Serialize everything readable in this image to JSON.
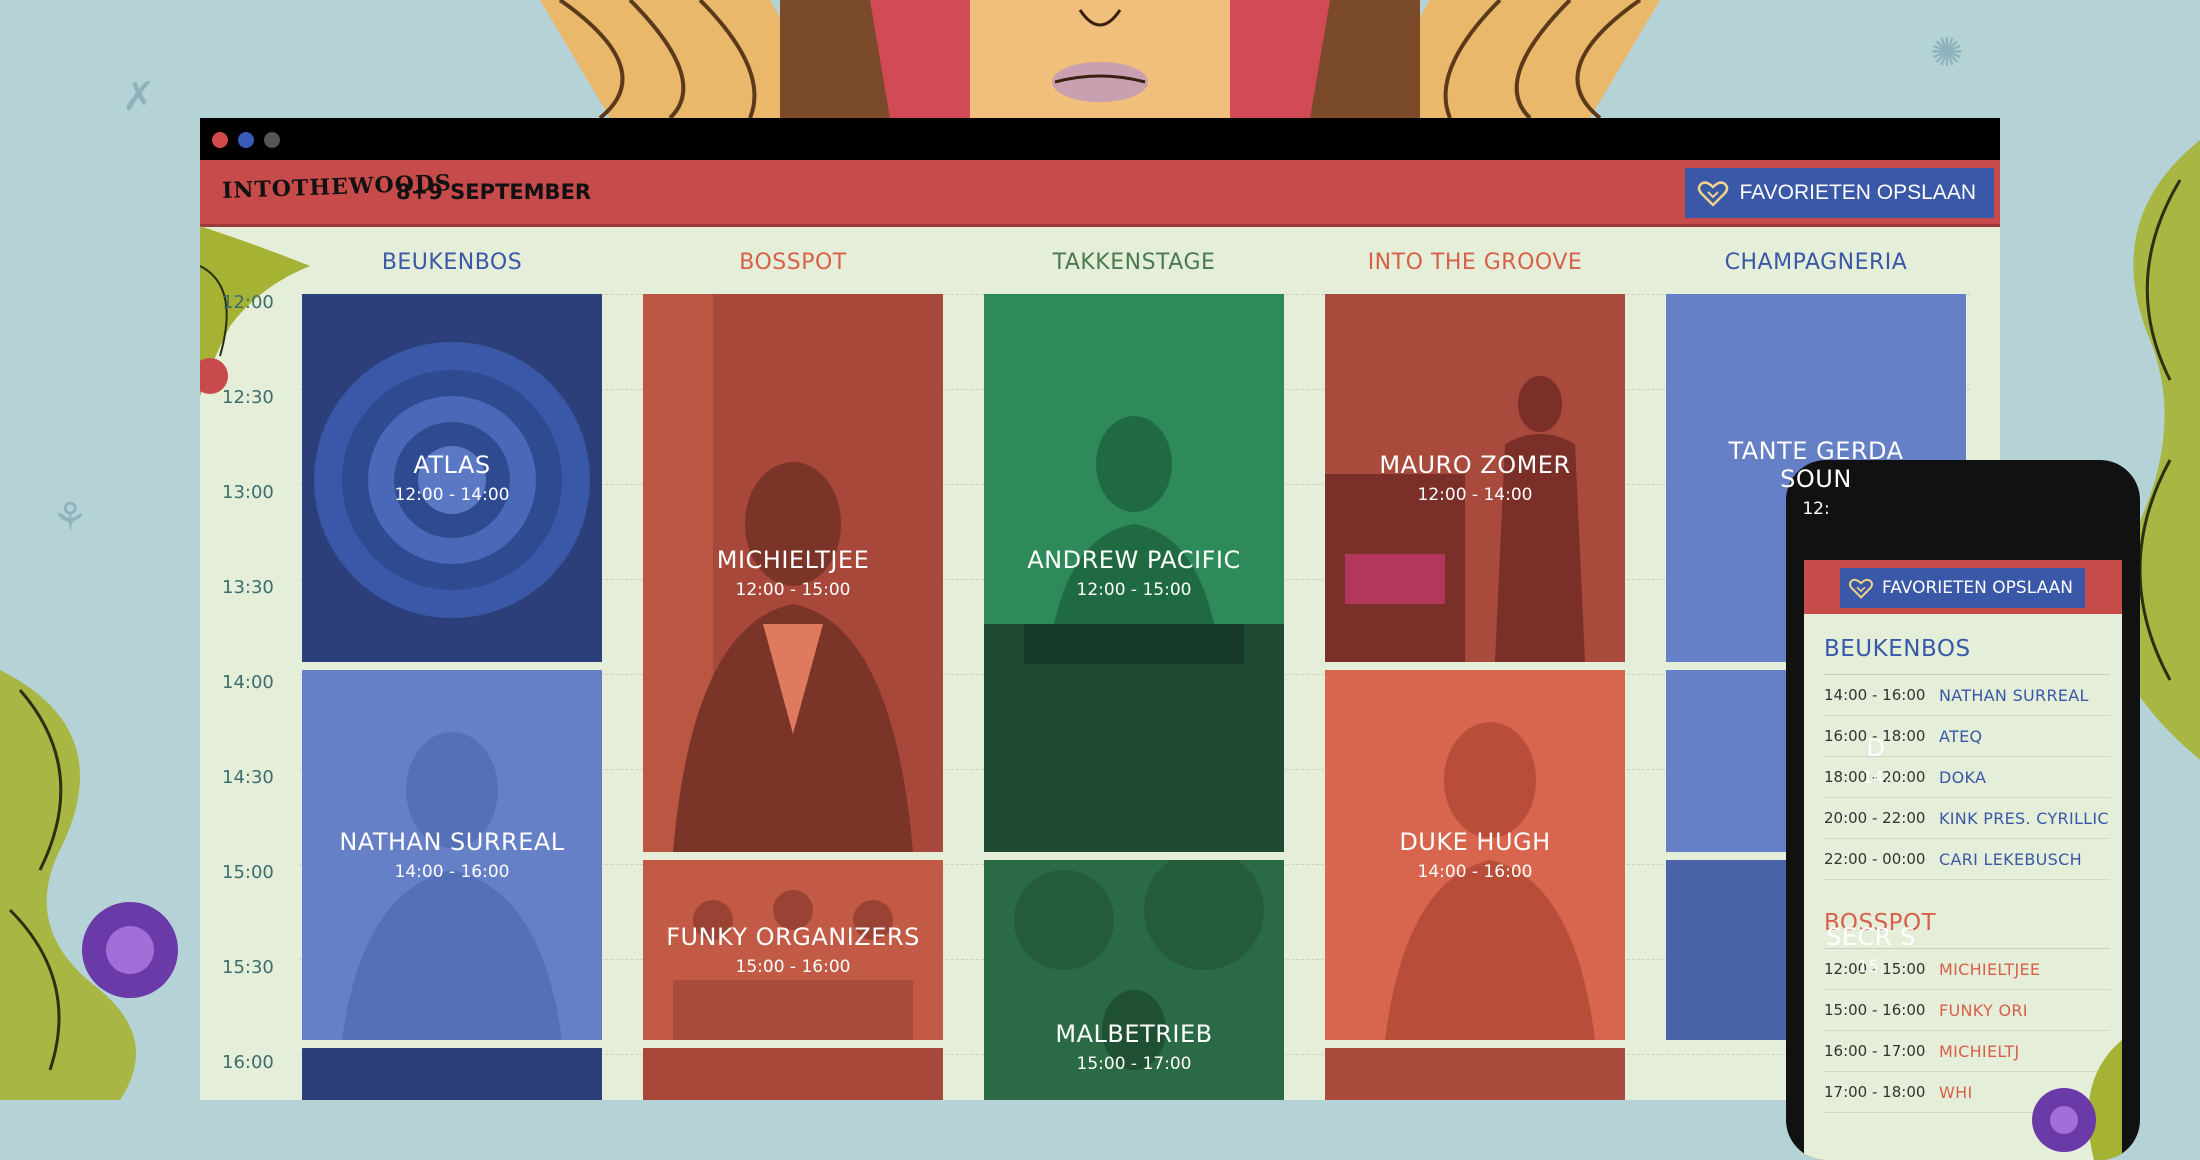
{
  "colors": {
    "background": "#b5d3d6",
    "header_red": "#c74b4a",
    "button_blue": "#3a58a8",
    "content_bg": "#e4eed8",
    "stage_blue": "#3a58a8",
    "stage_red": "#d8604a",
    "stage_green": "#4a7a4e"
  },
  "header": {
    "logo_text": "INTOTHEWOODS",
    "dates": "8+9 SEPTEMBER",
    "favorites_button": "FAVORIETEN OPSLAAN",
    "favorites_icon": "heart-icon"
  },
  "stages": [
    {
      "name": "BEUKENBOS",
      "color": "#3a58a8"
    },
    {
      "name": "BOSSPOT",
      "color": "#d8604a"
    },
    {
      "name": "TAKKENSTAGE",
      "color": "#4a7a4e"
    },
    {
      "name": "INTO THE GROOVE",
      "color": "#d8604a"
    },
    {
      "name": "CHAMPAGNERIA",
      "color": "#3a58a8"
    }
  ],
  "times": [
    "12:00",
    "12:30",
    "13:00",
    "13:30",
    "14:00",
    "14:30",
    "15:00",
    "15:30",
    "16:00"
  ],
  "timetable": {
    "atlas": {
      "artist": "ATLAS",
      "time": "12:00 - 14:00"
    },
    "nathan": {
      "artist": "NATHAN SURREAL",
      "time": "14:00 - 16:00"
    },
    "michieltjee": {
      "artist": "MICHIELTJEE",
      "time": "12:00 - 15:00"
    },
    "funky": {
      "artist": "FUNKY ORGANIZERS",
      "time": "15:00 - 16:00"
    },
    "andrew": {
      "artist": "ANDREW PACIFIC",
      "time": "12:00 - 15:00"
    },
    "malbetrieb": {
      "artist": "MALBETRIEB",
      "time": "15:00 - 17:00"
    },
    "mauro": {
      "artist": "MAURO ZOMER",
      "time": "12:00 - 14:00"
    },
    "duke": {
      "artist": "DUKE HUGH",
      "time": "14:00 - 16:00"
    },
    "tante": {
      "artist": "TANTE GERDA SOUN",
      "time": "12:"
    },
    "doka_partial": {
      "artist": "D",
      "time": "14:"
    },
    "secret_partial": {
      "artist": "SECR S",
      "time": "15:"
    }
  },
  "mobile": {
    "favorites_button": "FAVORIETEN OPSLAAN",
    "beukenbos": {
      "title": "BEUKENBOS",
      "rows": [
        {
          "time": "14:00 - 16:00",
          "artist": "NATHAN SURREAL"
        },
        {
          "time": "16:00 - 18:00",
          "artist": "ATEQ"
        },
        {
          "time": "18:00 - 20:00",
          "artist": "DOKA"
        },
        {
          "time": "20:00 - 22:00",
          "artist": "KINK PRES. CYRILLIC"
        },
        {
          "time": "22:00 - 00:00",
          "artist": "CARI LEKEBUSCH"
        }
      ]
    },
    "bosspot": {
      "title": "BOSSPOT",
      "rows": [
        {
          "time": "12:00 - 15:00",
          "artist": "MICHIELTJEE"
        },
        {
          "time": "15:00 - 16:00",
          "artist": "FUNKY ORI"
        },
        {
          "time": "16:00 - 17:00",
          "artist": "MICHIELTJ"
        },
        {
          "time": "17:00 - 18:00",
          "artist": "WHI"
        }
      ]
    }
  }
}
